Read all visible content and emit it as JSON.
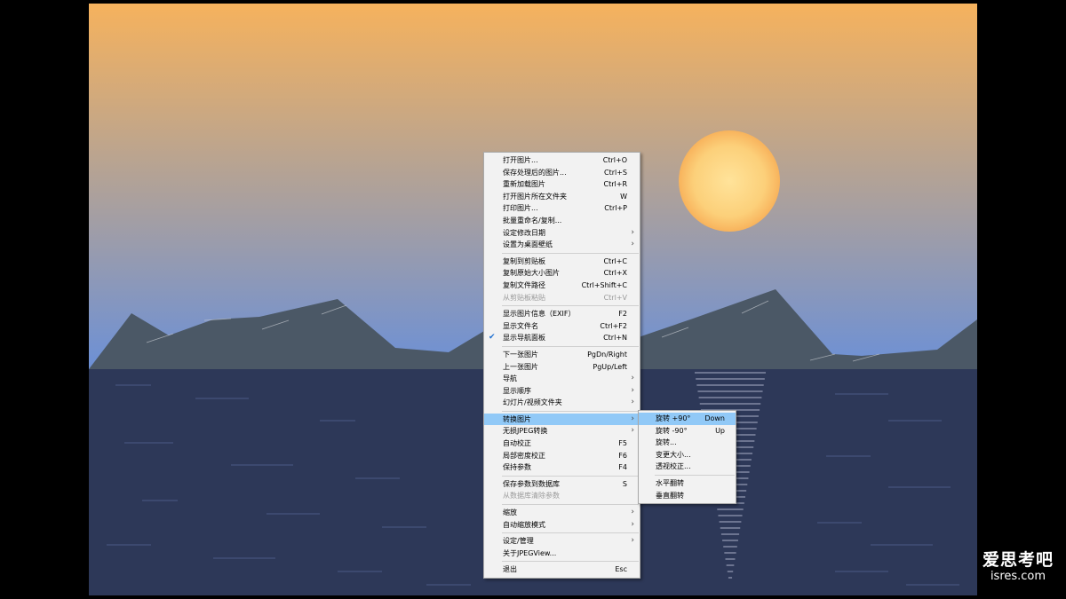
{
  "window": {
    "app": "JPEGView"
  },
  "colors": {
    "sky_top": "#f6b25d",
    "sky_mid": "#b6a393",
    "sky_bottom": "#6c90d6",
    "sun_center": "#ffe39a",
    "sun_edge": "#f8b35c",
    "mountain": "#4b5866",
    "sea": "#2d3858",
    "menu_bg": "#f2f2f2",
    "menu_highlight": "#91c9f7",
    "menu_disabled_text": "#9a9a9a"
  },
  "context_menu": {
    "items": [
      {
        "label": "打开图片...",
        "shortcut": "Ctrl+O"
      },
      {
        "label": "保存处理后的图片...",
        "shortcut": "Ctrl+S"
      },
      {
        "label": "重新加载图片",
        "shortcut": "Ctrl+R"
      },
      {
        "label": "打开图片所在文件夹",
        "shortcut": "W"
      },
      {
        "label": "打印图片...",
        "shortcut": "Ctrl+P"
      },
      {
        "label": "批量重命名/复制...",
        "shortcut": ""
      },
      {
        "label": "设定修改日期",
        "shortcut": "",
        "submenu": true
      },
      {
        "label": "设置为桌面壁纸",
        "shortcut": "",
        "submenu": true
      },
      {
        "separator": true
      },
      {
        "label": "复制到剪贴板",
        "shortcut": "Ctrl+C"
      },
      {
        "label": "复制原始大小图片",
        "shortcut": "Ctrl+X"
      },
      {
        "label": "复制文件路径",
        "shortcut": "Ctrl+Shift+C"
      },
      {
        "label": "从剪贴板粘贴",
        "shortcut": "Ctrl+V",
        "disabled": true
      },
      {
        "separator": true
      },
      {
        "label": "显示图片信息（EXIF）",
        "shortcut": "F2"
      },
      {
        "label": "显示文件名",
        "shortcut": "Ctrl+F2"
      },
      {
        "label": "显示导航面板",
        "shortcut": "Ctrl+N",
        "checked": true
      },
      {
        "separator": true
      },
      {
        "label": "下一张图片",
        "shortcut": "PgDn/Right"
      },
      {
        "label": "上一张图片",
        "shortcut": "PgUp/Left"
      },
      {
        "label": "导航",
        "shortcut": "",
        "submenu": true
      },
      {
        "label": "显示顺序",
        "shortcut": "",
        "submenu": true
      },
      {
        "label": "幻灯片/视频文件夹",
        "shortcut": "",
        "submenu": true
      },
      {
        "separator": true
      },
      {
        "label": "转换图片",
        "shortcut": "",
        "submenu": true,
        "highlighted": true
      },
      {
        "label": "无损JPEG转换",
        "shortcut": "",
        "submenu": true
      },
      {
        "label": "自动校正",
        "shortcut": "F5"
      },
      {
        "label": "局部密度校正",
        "shortcut": "F6"
      },
      {
        "label": "保持参数",
        "shortcut": "F4"
      },
      {
        "separator": true
      },
      {
        "label": "保存参数到数据库",
        "shortcut": "S"
      },
      {
        "label": "从数据库清除参数",
        "shortcut": "",
        "disabled": true
      },
      {
        "separator": true
      },
      {
        "label": "缩放",
        "shortcut": "",
        "submenu": true
      },
      {
        "label": "自动缩放模式",
        "shortcut": "",
        "submenu": true
      },
      {
        "separator": true
      },
      {
        "label": "设定/管理",
        "shortcut": "",
        "submenu": true
      },
      {
        "label": "关于JPEGView...",
        "shortcut": ""
      },
      {
        "separator": true
      },
      {
        "label": "退出",
        "shortcut": "Esc"
      }
    ]
  },
  "transform_submenu": {
    "items": [
      {
        "label": "旋转 +90°",
        "shortcut": "Down",
        "highlighted": true
      },
      {
        "label": "旋转 -90°",
        "shortcut": "Up"
      },
      {
        "label": "旋转...",
        "shortcut": ""
      },
      {
        "label": "变更大小...",
        "shortcut": ""
      },
      {
        "label": "透视校正...",
        "shortcut": ""
      },
      {
        "separator": true
      },
      {
        "label": "水平翻转",
        "shortcut": ""
      },
      {
        "label": "垂直翻转",
        "shortcut": ""
      }
    ]
  },
  "icons": {
    "submenu_arrow": "chevron-right-icon",
    "check": "checkmark-icon"
  },
  "watermark": {
    "cn": "爱思考吧",
    "en": "isres.com"
  }
}
